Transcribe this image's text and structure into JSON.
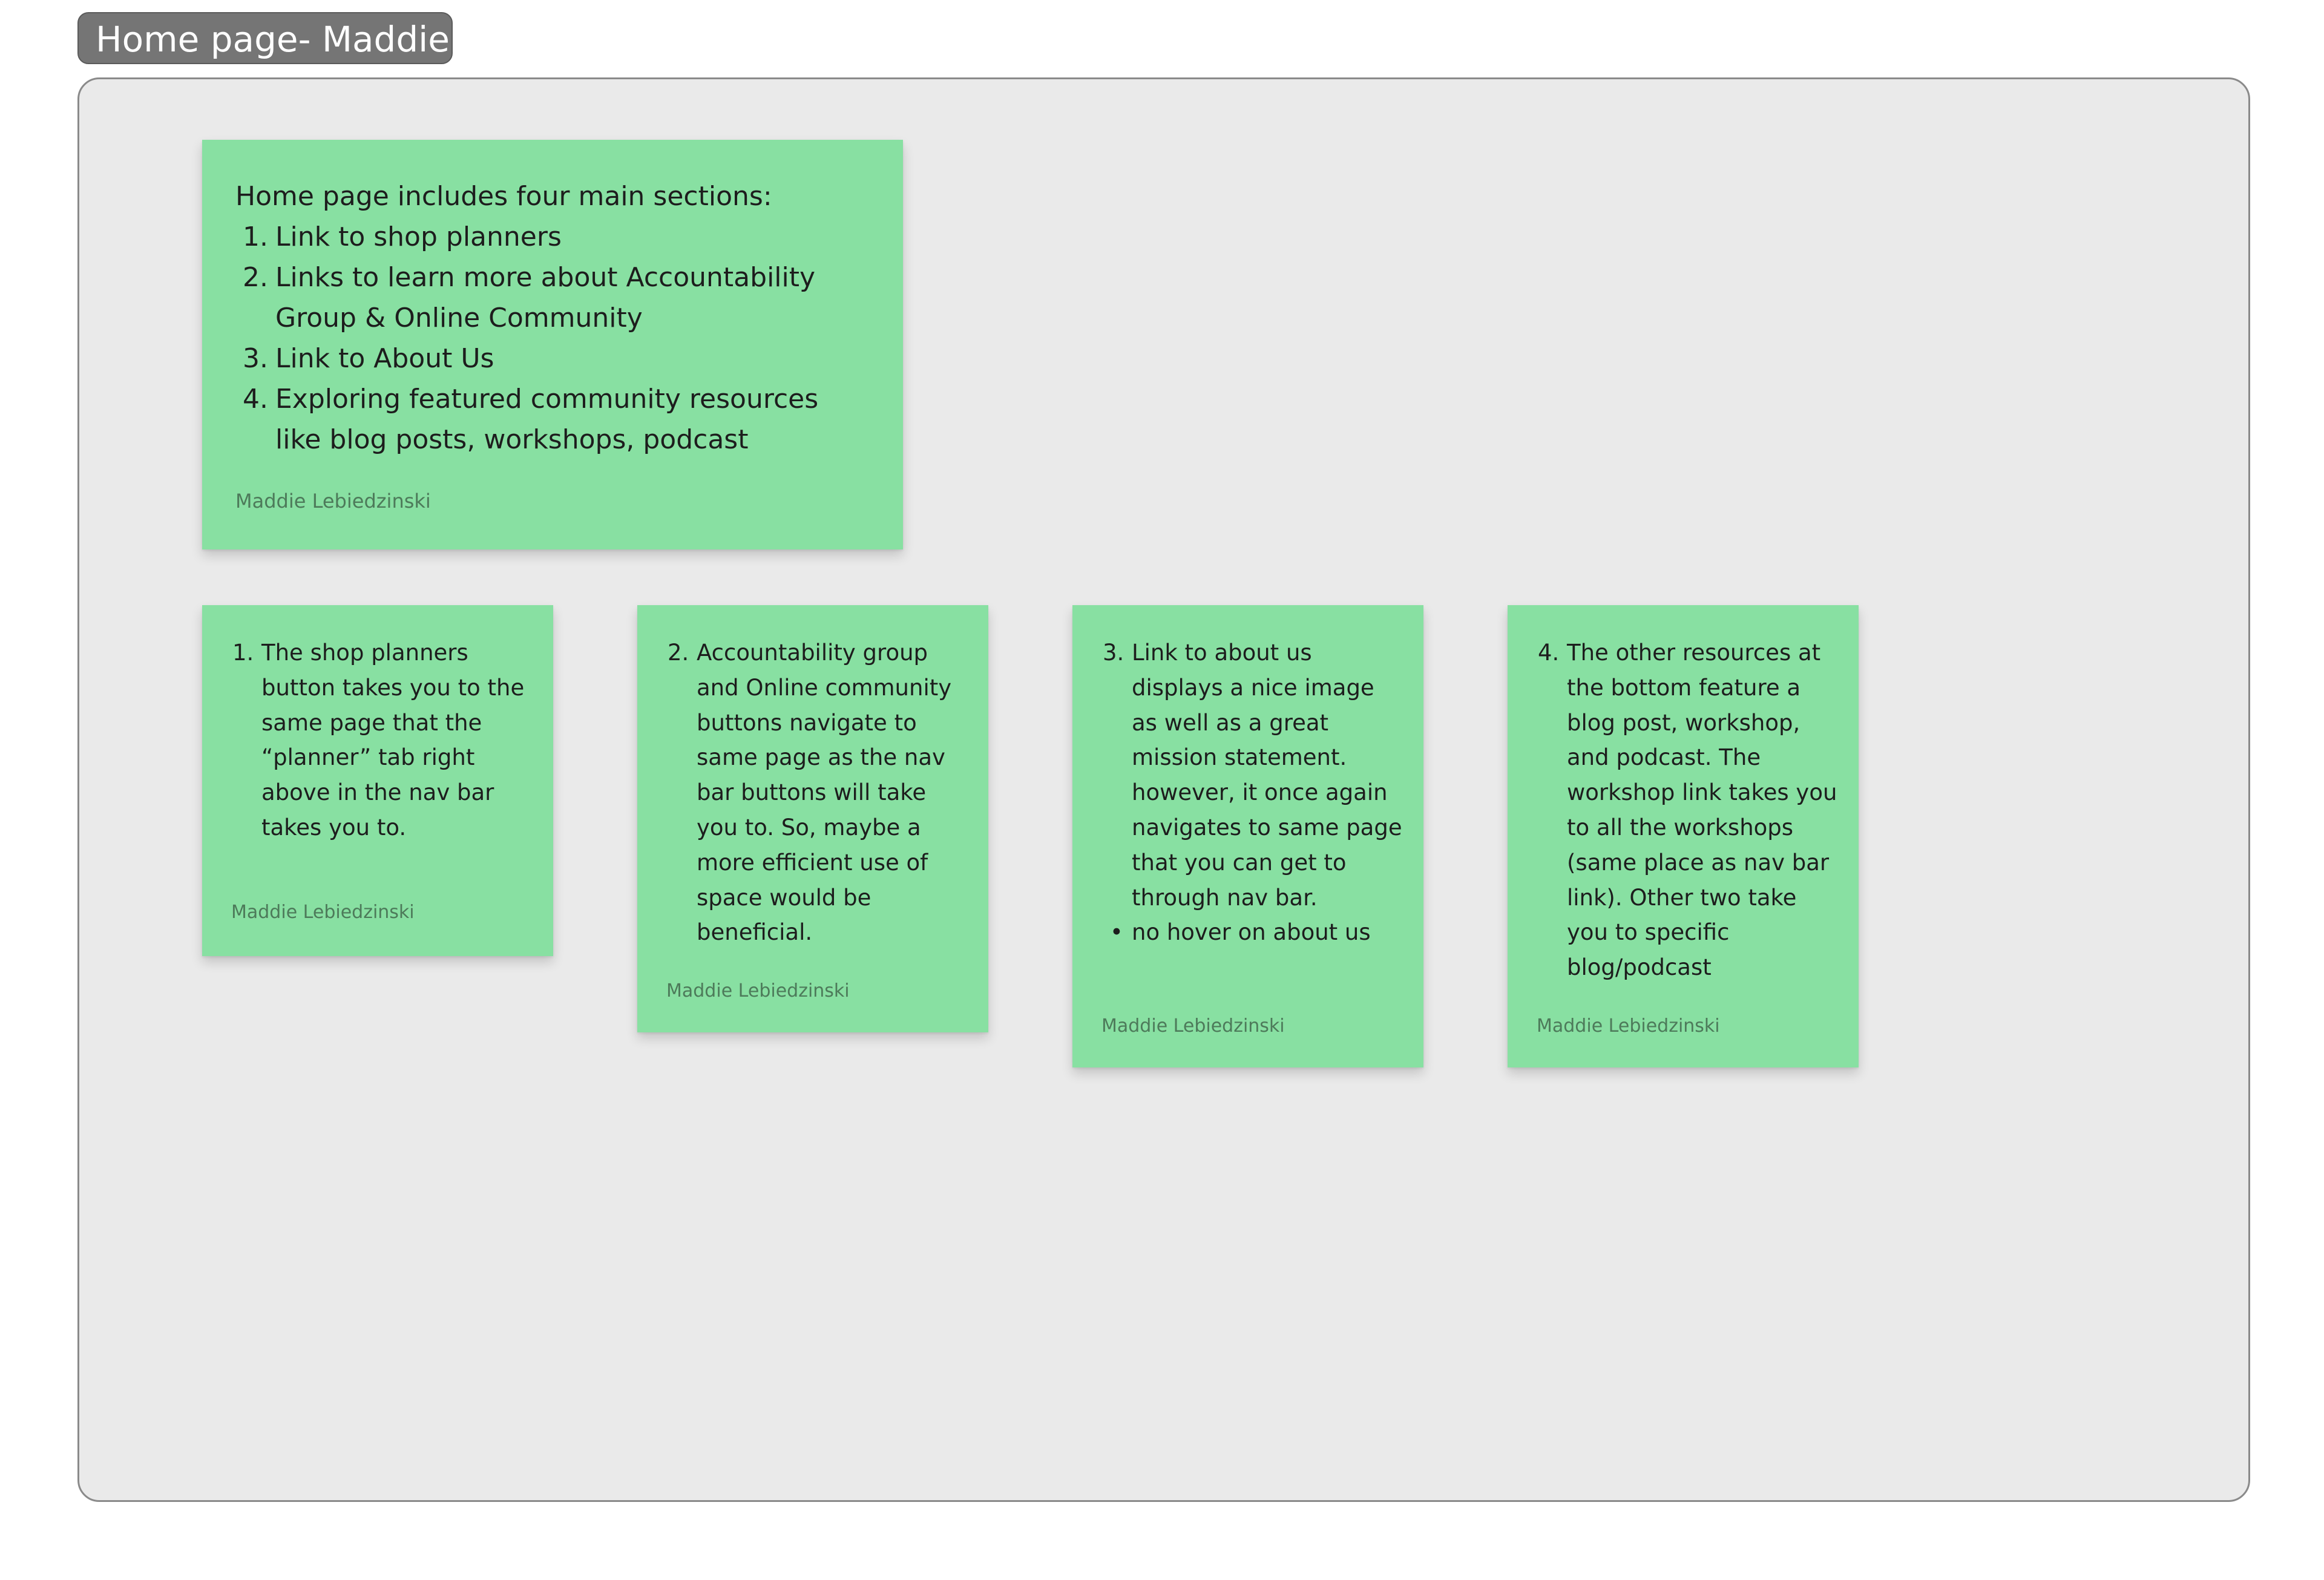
{
  "section": {
    "title": "Home page- Maddie"
  },
  "main_note": {
    "intro": "Home page includes four main sections:",
    "items": [
      {
        "num": "1.",
        "text": "Link to shop planners"
      },
      {
        "num": "2.",
        "text": "Links to learn more about Accountability Group & Online Community"
      },
      {
        "num": "3.",
        "text": "Link to About Us"
      },
      {
        "num": "4.",
        "text": "Exploring featured community resources like blog posts, workshops, podcast"
      }
    ],
    "author": "Maddie Lebiedzinski"
  },
  "notes": [
    {
      "num": "1.",
      "text": "The shop planners button takes you to the same page that the “planner” tab right above in the nav bar takes you to.",
      "author": "Maddie Lebiedzinski"
    },
    {
      "num": "2.",
      "text": "Accountability group and Online community buttons navigate to same page as the nav bar buttons will take you to. So, maybe a more efficient use of space would be beneficial.",
      "author": "Maddie Lebiedzinski"
    },
    {
      "num": "3.",
      "text": "Link to about us displays a nice image as well as a great mission statement. however, it once again navigates to same page that you can get to through nav bar.",
      "bullet": "no hover on about us",
      "author": "Maddie Lebiedzinski"
    },
    {
      "num": "4.",
      "text": "The other resources at the bottom feature a blog post, workshop, and podcast. The workshop link takes you to all the workshops (same place as nav bar link). Other two take you to specific blog/podcast",
      "author": "Maddie Lebiedzinski"
    }
  ],
  "colors": {
    "sticky": "#88e0a2",
    "section_bg": "#eaeaea",
    "label_bg": "#757575"
  }
}
